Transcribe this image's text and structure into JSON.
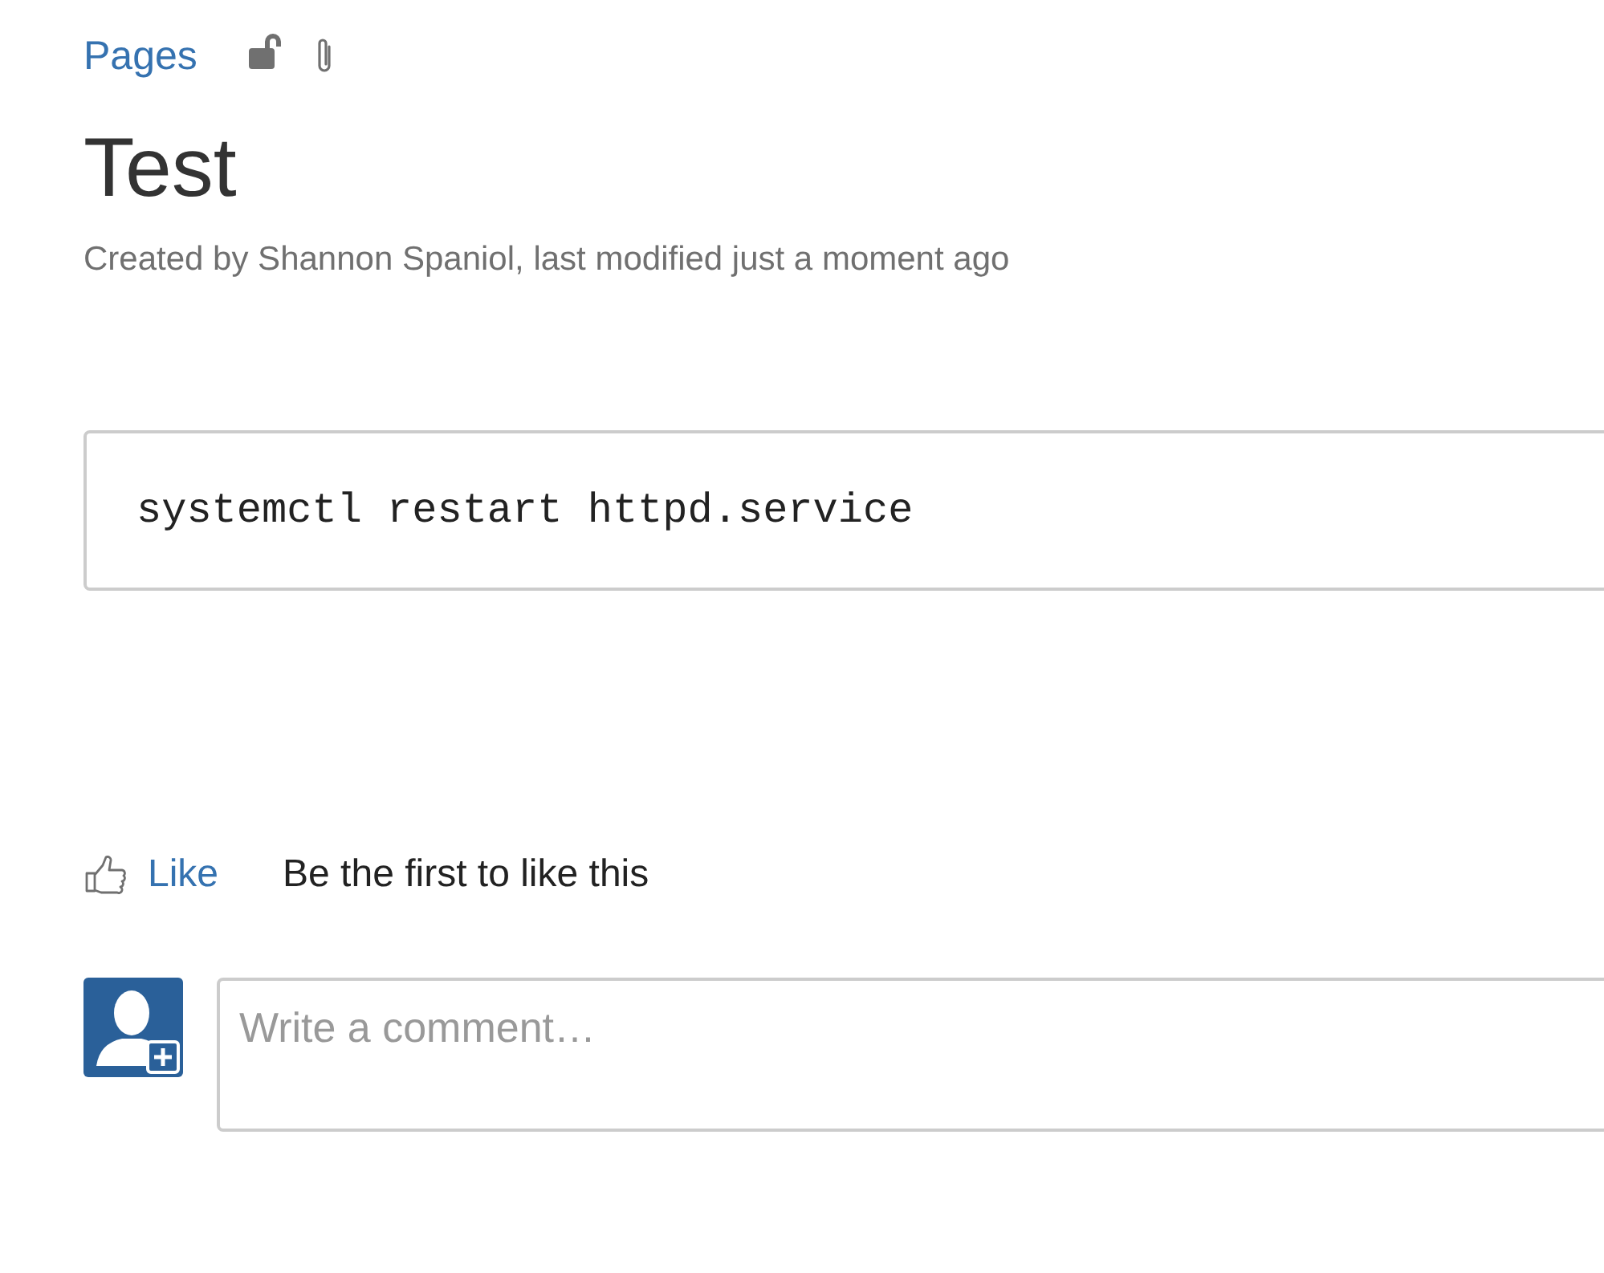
{
  "breadcrumb": {
    "label": "Pages"
  },
  "page": {
    "title": "Test",
    "byline": "Created by Shannon Spaniol, last modified just a moment ago"
  },
  "code_block": {
    "code": "systemctl restart httpd.service"
  },
  "like": {
    "label": "Like",
    "summary": "Be the first to like this"
  },
  "comment": {
    "placeholder": "Write a comment…"
  }
}
